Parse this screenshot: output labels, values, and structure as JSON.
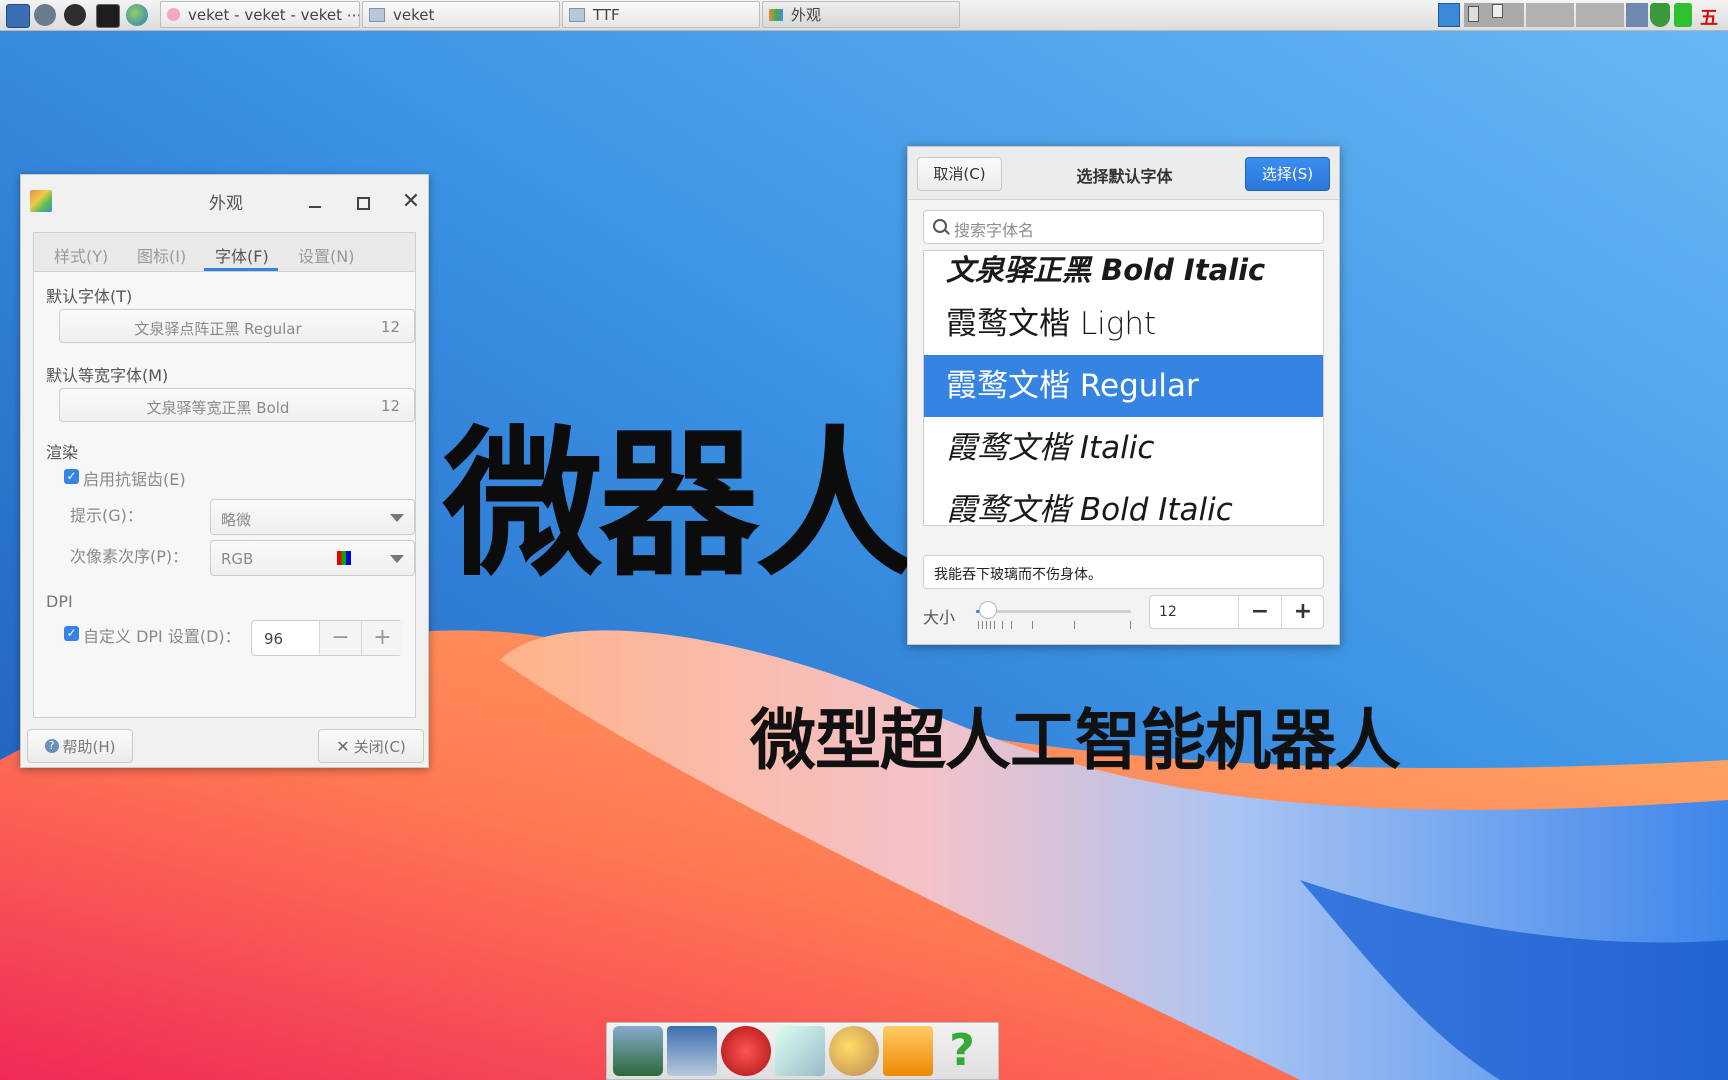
{
  "taskbar": {
    "tasks": [
      {
        "label": "veket - veket - veket ⋯"
      },
      {
        "label": "veket"
      },
      {
        "label": "TTF"
      },
      {
        "label": "外观"
      }
    ],
    "ime_label": "五"
  },
  "desktop": {
    "big_text": "微器人",
    "sub_text": "微型超人工智能机器人"
  },
  "appearance": {
    "title": "外观",
    "tabs": [
      "样式(Y)",
      "图标(I)",
      "字体(F)",
      "设置(N)"
    ],
    "default_font_label": "默认字体(T)",
    "default_font_name": "文泉驿点阵正黑 Regular",
    "default_font_size": "12",
    "mono_font_label": "默认等宽字体(M)",
    "mono_font_name": "文泉驿等宽正黑 Bold",
    "mono_font_size": "12",
    "render_label": "渲染",
    "antialias_label": "启用抗锯齿(E)",
    "hint_label": "提示(G)：",
    "hint_value": "略微",
    "subpixel_label": "次像素次序(P)：",
    "subpixel_value": "RGB",
    "dpi_section": "DPI",
    "dpi_custom_label": "自定义 DPI 设置(D)：",
    "dpi_value": "96",
    "help_button": "帮助(H)",
    "close_button": "关闭(C)"
  },
  "fontchooser": {
    "cancel_button": "取消(C)",
    "title": "选择默认字体",
    "select_button": "选择(S)",
    "search_placeholder": "搜索字体名",
    "fonts": [
      {
        "label": "文泉驿正黑 Bold Italic",
        "selected": false
      },
      {
        "label": "霞鹜文楷 Light",
        "selected": false
      },
      {
        "label": "霞鹜文楷 Regular",
        "selected": true
      },
      {
        "label": "霞鹜文楷 Italic",
        "selected": false
      },
      {
        "label": "霞鹜文楷 Bold Italic",
        "selected": false
      }
    ],
    "preview_text": "我能吞下玻璃而不伤身体。",
    "size_label": "大小",
    "size_value": "12",
    "size_slider_fraction": 0.08
  },
  "colors": {
    "accent": "#3584e4"
  }
}
